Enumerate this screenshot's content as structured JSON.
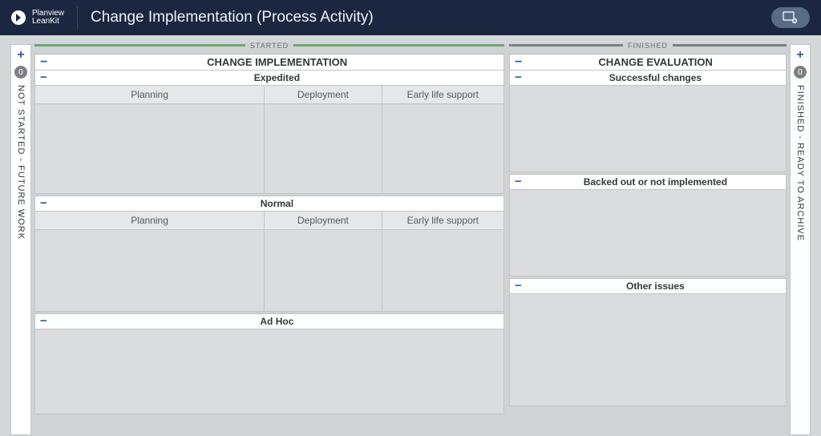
{
  "brand": {
    "line1": "Planview",
    "line2": "LeanKit"
  },
  "board_title": "Change Implementation (Process Activity)",
  "side_left": {
    "count": "0",
    "label": "NOT STARTED - FUTURE WORK"
  },
  "side_right": {
    "count": "0",
    "label": "FINISHED - READY TO ARCHIVE"
  },
  "started": {
    "cap": "STARTED",
    "title": "CHANGE IMPLEMENTATION",
    "expedited": {
      "title": "Expedited",
      "cols": {
        "plan": "Planning",
        "dep": "Deployment",
        "els": "Early life support"
      }
    },
    "normal": {
      "title": "Normal",
      "cols": {
        "plan": "Planning",
        "dep": "Deployment",
        "els": "Early life support"
      }
    },
    "adhoc": {
      "title": "Ad Hoc"
    }
  },
  "finished": {
    "cap": "FINISHED",
    "title": "CHANGE EVALUATION",
    "lanes": {
      "success": "Successful changes",
      "backed": "Backed out or not implemented",
      "other": "Other issues"
    }
  }
}
